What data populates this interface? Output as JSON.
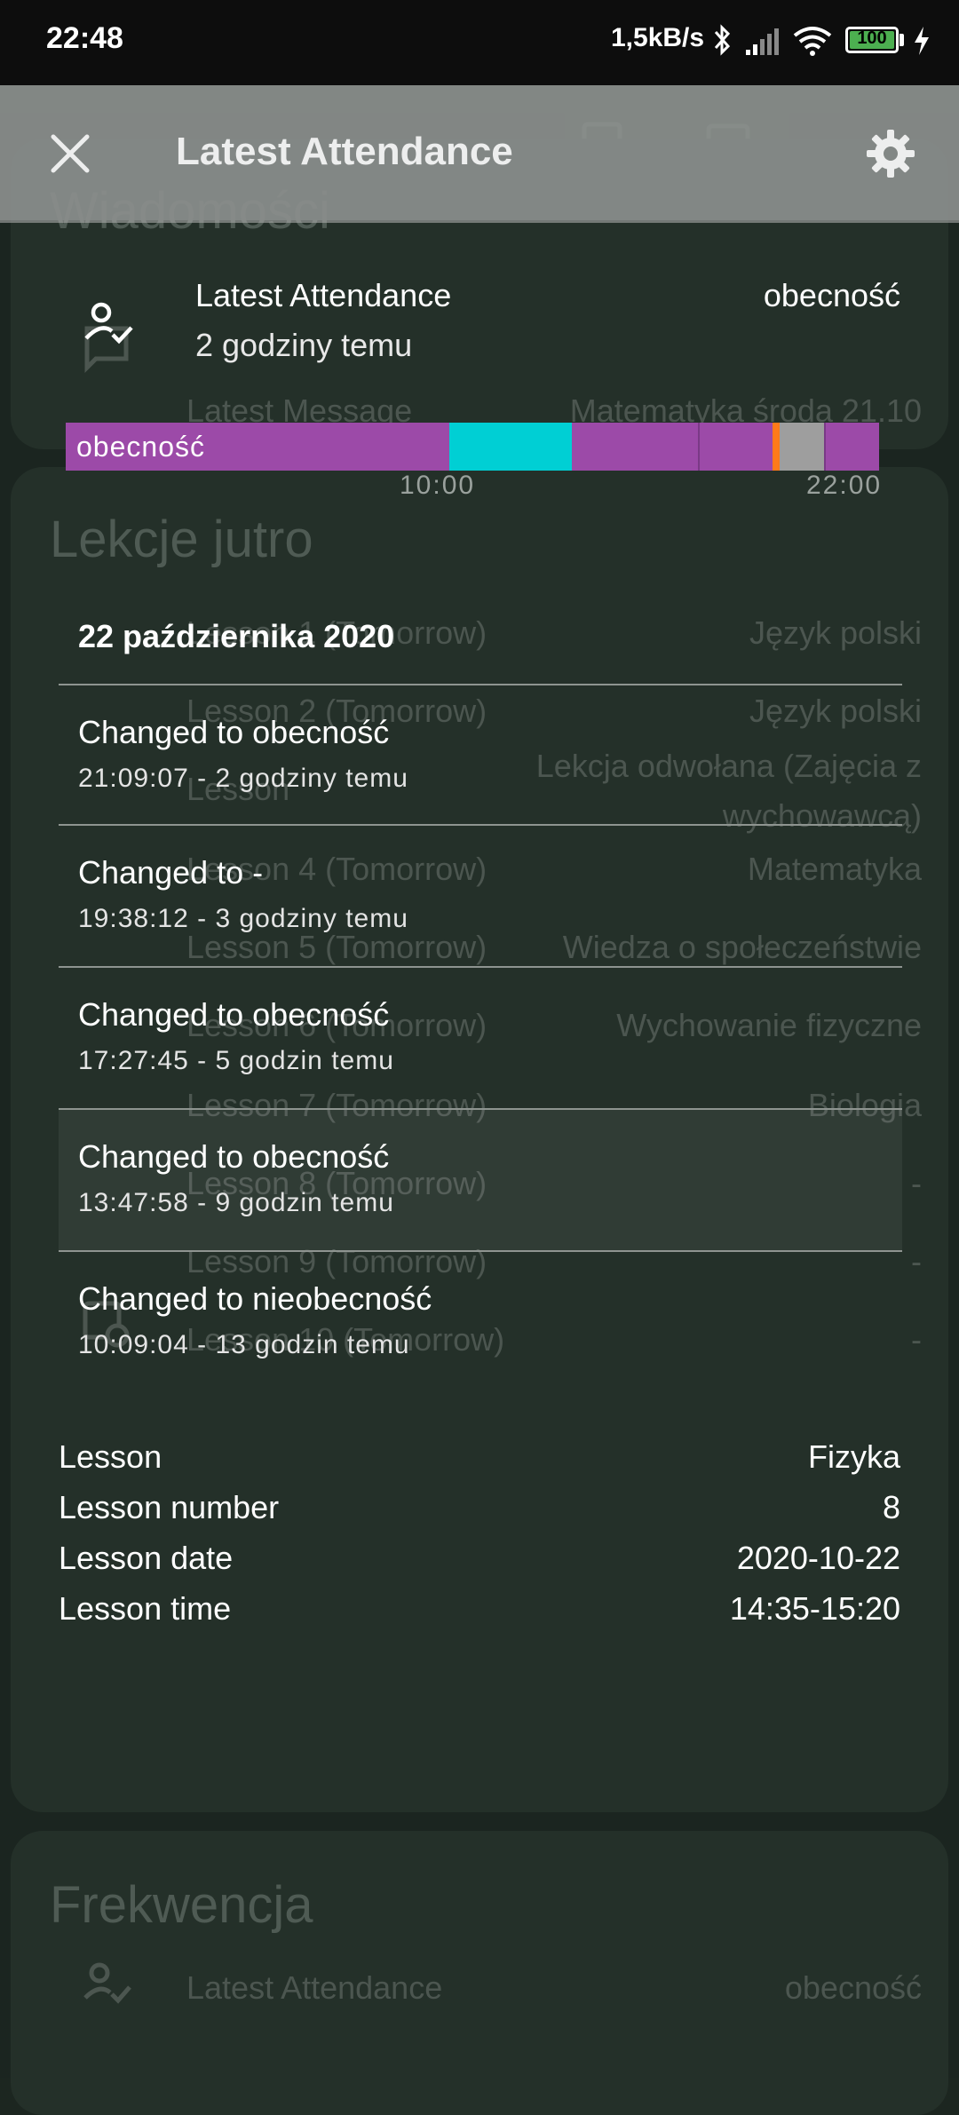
{
  "status_bar": {
    "time": "22:48",
    "speed": "1,5kB/s",
    "battery": "100",
    "icons": [
      "bluetooth-icon",
      "signal-icon",
      "wifi-icon",
      "battery-icon",
      "charging-icon"
    ]
  },
  "background": {
    "tab_icons": [
      "timetable-icon",
      "calendar-icon"
    ],
    "messages_card": {
      "title": "Wiadomości",
      "row": {
        "label": "Latest Message",
        "value": "Matematyka środa 21.10"
      }
    },
    "lessons_card": {
      "title": "Lekcje jutro",
      "rows": [
        {
          "label": "Lesson 1 (Tomorrow)",
          "value": "Język polski"
        },
        {
          "label": "Lesson 2 (Tomorrow)",
          "value": "Język polski"
        },
        {
          "label": "Lesson",
          "value": "Lekcja odwołana (Zajęcia z",
          "value2": "wychowawcą)"
        },
        {
          "label": "Lesson 4 (Tomorrow)",
          "value": "Matematyka"
        },
        {
          "label": "Lesson 5 (Tomorrow)",
          "value": "Wiedza o społeczeństwie"
        },
        {
          "label": "Lesson 6 (Tomorrow)",
          "value": "Wychowanie fizyczne"
        },
        {
          "label": "Lesson 7 (Tomorrow)",
          "value": "Biologia"
        },
        {
          "label": "Lesson 8 (Tomorrow)",
          "value": "-"
        },
        {
          "label": "Lesson 9 (Tomorrow)",
          "value": "-"
        },
        {
          "label": "Lesson 10 (Tomorrow)",
          "value": "-"
        }
      ]
    },
    "attendance_card": {
      "title": "Frekwencja",
      "row": {
        "label": "Latest Attendance",
        "value": "obecność"
      }
    }
  },
  "appbar": {
    "title": "Latest Attendance",
    "close_icon": "close-icon",
    "settings_icon": "gear-icon"
  },
  "dialog": {
    "header": {
      "title": "Latest Attendance",
      "value": "obecność",
      "subtitle": "2 godziny temu"
    },
    "timeline": {
      "label": "obecność",
      "ticks": [
        "10:00",
        "22:00"
      ],
      "colors": {
        "present": "#9c4aa8",
        "cyan": "#00cfd4",
        "orange": "#ff7a1a",
        "gray": "#9e9e9e"
      }
    },
    "date": "22 października 2020",
    "history": [
      {
        "title": "Changed to obecność",
        "sub": "21:09:07 - 2 godziny temu"
      },
      {
        "title": "Changed to -",
        "sub": "19:38:12 - 3 godziny temu"
      },
      {
        "title": "Changed to obecność",
        "sub": "17:27:45 - 5 godzin temu"
      },
      {
        "title": "Changed to obecność",
        "sub": "13:47:58 - 9 godzin temu"
      },
      {
        "title": "Changed to nieobecność",
        "sub": "10:09:04 - 13 godzin temu"
      }
    ],
    "details": [
      {
        "label": "Lesson",
        "value": "Fizyka"
      },
      {
        "label": "Lesson number",
        "value": "8"
      },
      {
        "label": "Lesson date",
        "value": "2020-10-22"
      },
      {
        "label": "Lesson time",
        "value": "14:35-15:20"
      }
    ]
  }
}
